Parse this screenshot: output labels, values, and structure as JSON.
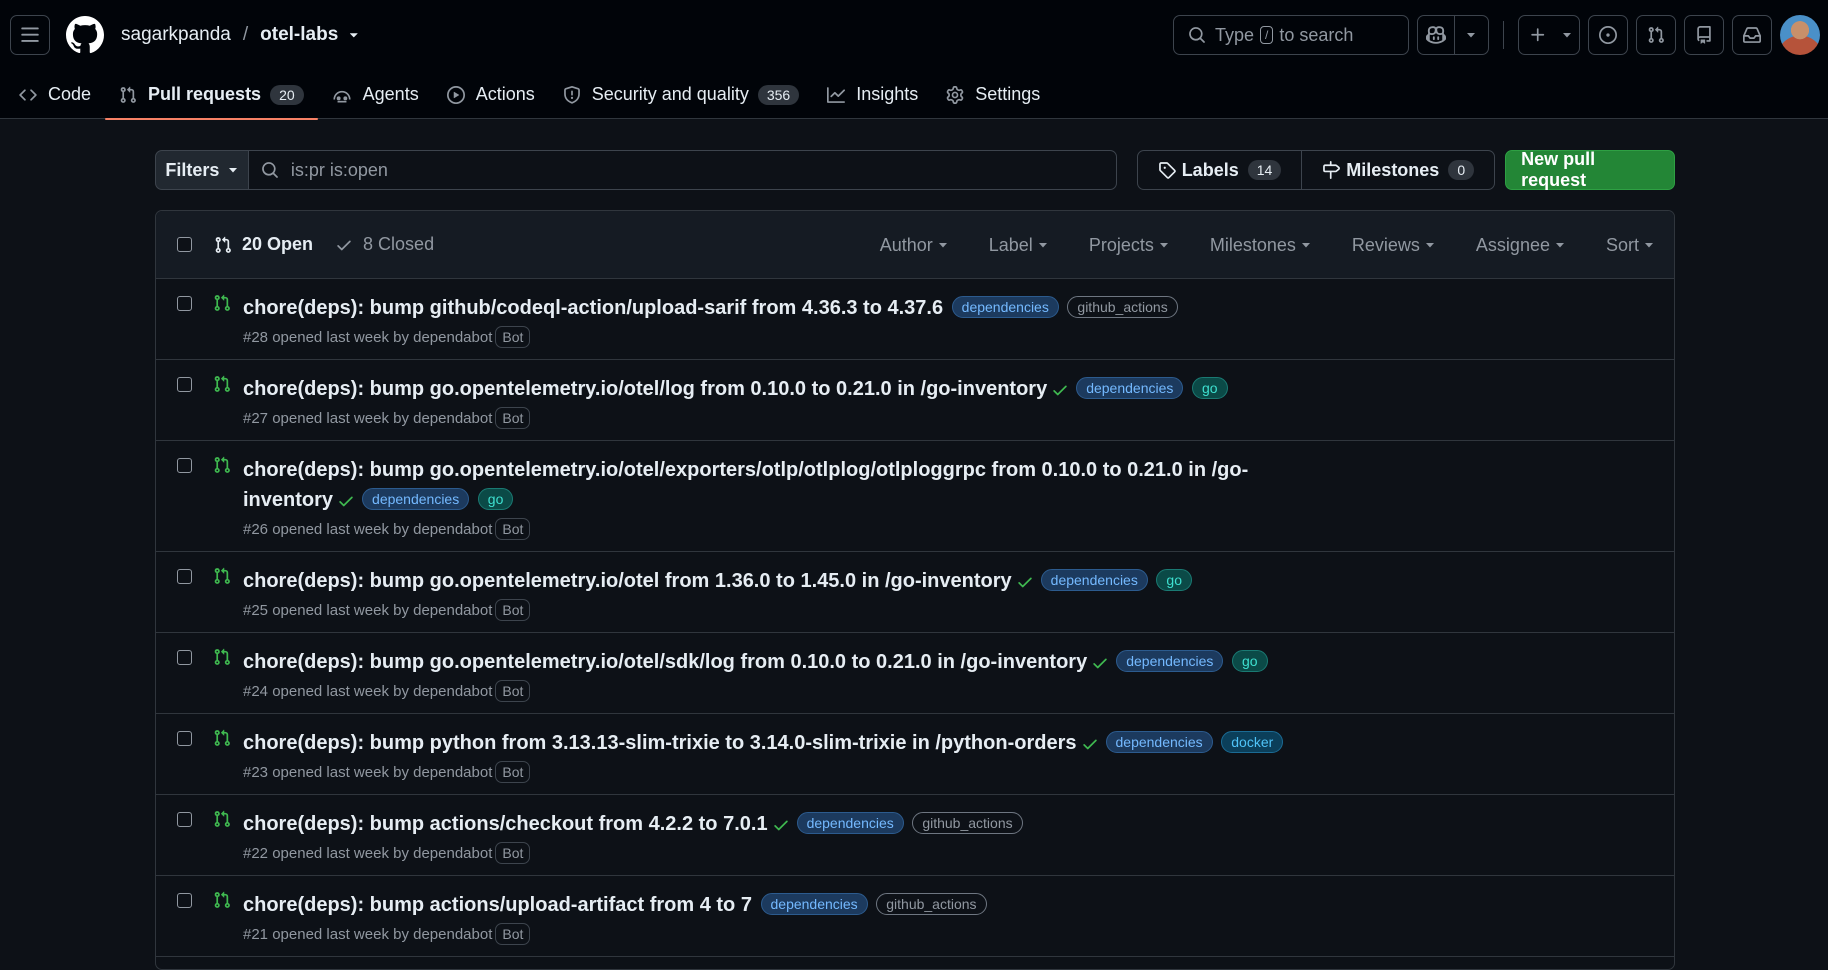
{
  "header": {
    "owner": "sagarkpanda",
    "separator": "/",
    "repo": "otel-labs",
    "search": {
      "prefix": "Type",
      "key": "/",
      "suffix": "to search"
    }
  },
  "tabs": [
    {
      "label": "Code",
      "icon": "code-icon",
      "counter": ""
    },
    {
      "label": "Pull requests",
      "icon": "git-pull-request-icon",
      "counter": "20"
    },
    {
      "label": "Agents",
      "icon": "agents-icon",
      "counter": ""
    },
    {
      "label": "Actions",
      "icon": "play-icon",
      "counter": ""
    },
    {
      "label": "Security and quality",
      "icon": "shield-icon",
      "counter": "356"
    },
    {
      "label": "Insights",
      "icon": "graph-icon",
      "counter": ""
    },
    {
      "label": "Settings",
      "icon": "gear-icon",
      "counter": ""
    }
  ],
  "toolbar": {
    "filters_label": "Filters",
    "filter_value": "is:pr is:open",
    "labels_label": "Labels",
    "labels_count": "14",
    "milestones_label": "Milestones",
    "milestones_count": "0",
    "new_pr_label": "New pull request"
  },
  "list": {
    "open_label": "20 Open",
    "closed_label": "8 Closed",
    "sorts": [
      "Author",
      "Label",
      "Projects",
      "Milestones",
      "Reviews",
      "Assignee",
      "Sort"
    ]
  },
  "prs": [
    {
      "title": "chore(deps): bump github/codeql-action/upload-sarif from 4.36.3 to 4.37.6",
      "check": false,
      "labels": [
        "dependencies",
        "github_actions"
      ],
      "meta": "#28 opened last week by dependabot",
      "badge": "Bot"
    },
    {
      "title": "chore(deps): bump go.opentelemetry.io/otel/log from 0.10.0 to 0.21.0 in /go-inventory",
      "check": true,
      "labels": [
        "dependencies",
        "go"
      ],
      "meta": "#27 opened last week by dependabot",
      "badge": "Bot"
    },
    {
      "title": "chore(deps): bump go.opentelemetry.io/otel/exporters/otlp/otlplog/otlploggrpc from 0.10.0 to 0.21.0 in /go-inventory",
      "check": true,
      "labels": [
        "dependencies",
        "go"
      ],
      "meta": "#26 opened last week by dependabot",
      "badge": "Bot"
    },
    {
      "title": "chore(deps): bump go.opentelemetry.io/otel from 1.36.0 to 1.45.0 in /go-inventory",
      "check": true,
      "labels": [
        "dependencies",
        "go"
      ],
      "meta": "#25 opened last week by dependabot",
      "badge": "Bot"
    },
    {
      "title": "chore(deps): bump go.opentelemetry.io/otel/sdk/log from 0.10.0 to 0.21.0 in /go-inventory",
      "check": true,
      "labels": [
        "dependencies",
        "go"
      ],
      "meta": "#24 opened last week by dependabot",
      "badge": "Bot"
    },
    {
      "title": "chore(deps): bump python from 3.13.13-slim-trixie to 3.14.0-slim-trixie in /python-orders",
      "check": true,
      "labels": [
        "dependencies",
        "docker"
      ],
      "meta": "#23 opened last week by dependabot",
      "badge": "Bot"
    },
    {
      "title": "chore(deps): bump actions/checkout from 4.2.2 to 7.0.1",
      "check": true,
      "labels": [
        "dependencies",
        "github_actions"
      ],
      "meta": "#22 opened last week by dependabot",
      "badge": "Bot"
    },
    {
      "title": "chore(deps): bump actions/upload-artifact from 4 to 7",
      "check": false,
      "labels": [
        "dependencies",
        "github_actions"
      ],
      "meta": "#21 opened last week by dependabot",
      "badge": "Bot"
    }
  ]
}
